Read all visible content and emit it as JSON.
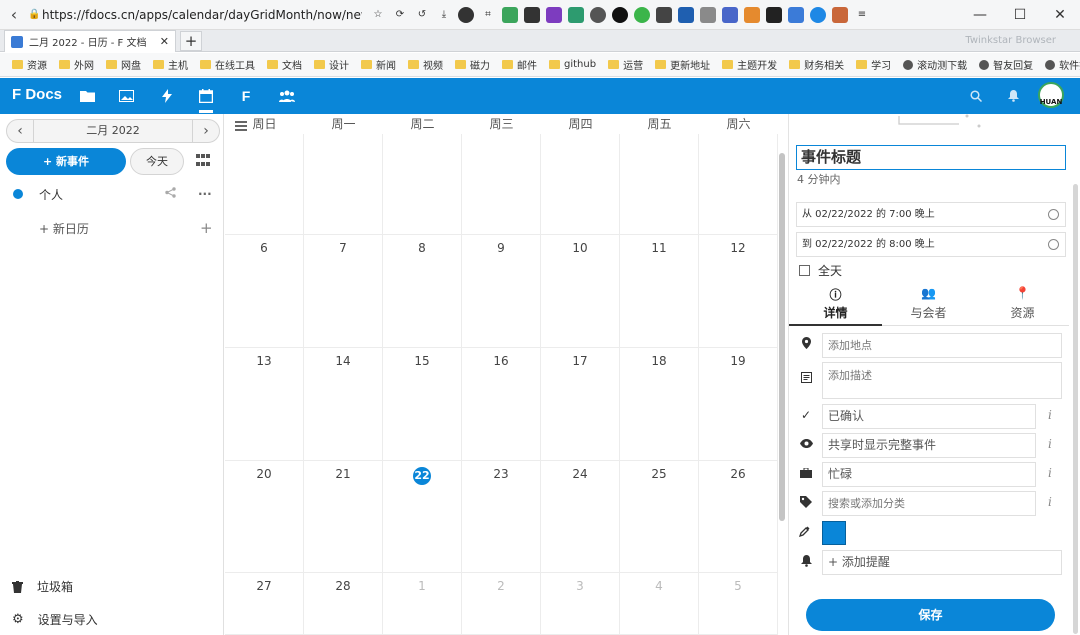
{
  "browser": {
    "url": "https://fdocs.cn/apps/calendar/dayGridMonth/now/new/si...",
    "tab_title": "二月 2022 - 日历 - F 文档",
    "brand": "Twinkstar Browser",
    "bookmarks": [
      "资源",
      "外网",
      "网盘",
      "主机",
      "在线工具",
      "文档",
      "设计",
      "新闻",
      "视频",
      "磁力",
      "邮件",
      "github",
      "运营",
      "更新地址",
      "主题开发",
      "财务相关",
      "学习"
    ],
    "bookmarks_globe": [
      "滚动测下载",
      "智友回复",
      "软件搜索"
    ]
  },
  "app": {
    "logo": "F Docs",
    "avatar_text": "HUAN"
  },
  "sidebar": {
    "month_label": "二月 2022",
    "new_event_label": "+ 新事件",
    "today_label": "今天",
    "calendar_name": "个人",
    "new_calendar_label": "+ 新日历",
    "trash_label": "垃圾箱",
    "settings_label": "设置与导入"
  },
  "calendar": {
    "weekdays": [
      "周日",
      "周一",
      "周二",
      "周三",
      "周四",
      "周五",
      "周六"
    ],
    "today": "22",
    "weeks": [
      [
        {
          "d": "",
          "m": false
        },
        {
          "d": "",
          "m": false
        },
        {
          "d": "",
          "m": false
        },
        {
          "d": "",
          "m": false
        },
        {
          "d": "",
          "m": false
        },
        {
          "d": "",
          "m": false
        },
        {
          "d": "",
          "m": false
        }
      ],
      [
        {
          "d": "6"
        },
        {
          "d": "7"
        },
        {
          "d": "8"
        },
        {
          "d": "9"
        },
        {
          "d": "10"
        },
        {
          "d": "11"
        },
        {
          "d": "12"
        }
      ],
      [
        {
          "d": "13"
        },
        {
          "d": "14"
        },
        {
          "d": "15"
        },
        {
          "d": "16"
        },
        {
          "d": "17"
        },
        {
          "d": "18"
        },
        {
          "d": "19"
        }
      ],
      [
        {
          "d": "20"
        },
        {
          "d": "21"
        },
        {
          "d": "22"
        },
        {
          "d": "23"
        },
        {
          "d": "24"
        },
        {
          "d": "25"
        },
        {
          "d": "26"
        }
      ],
      [
        {
          "d": "27"
        },
        {
          "d": "28"
        },
        {
          "d": "1",
          "m": true
        },
        {
          "d": "2",
          "m": true
        },
        {
          "d": "3",
          "m": true
        },
        {
          "d": "4",
          "m": true
        },
        {
          "d": "5",
          "m": true
        }
      ]
    ]
  },
  "event": {
    "title": "事件标题",
    "subtitle": "4 分钟内",
    "from": "从 02/22/2022 的 7:00 晚上",
    "to": "到 02/22/2022 的 8:00 晚上",
    "all_day_label": "全天",
    "tabs": [
      "详情",
      "与会者",
      "资源"
    ],
    "location_placeholder": "添加地点",
    "description_placeholder": "添加描述",
    "status": "已确认",
    "visibility": "共享时显示完整事件",
    "busy": "忙碌",
    "category_placeholder": "搜索或添加分类",
    "reminder_label": "+ 添加提醒",
    "color": "#0a86d8",
    "save_label": "保存"
  }
}
